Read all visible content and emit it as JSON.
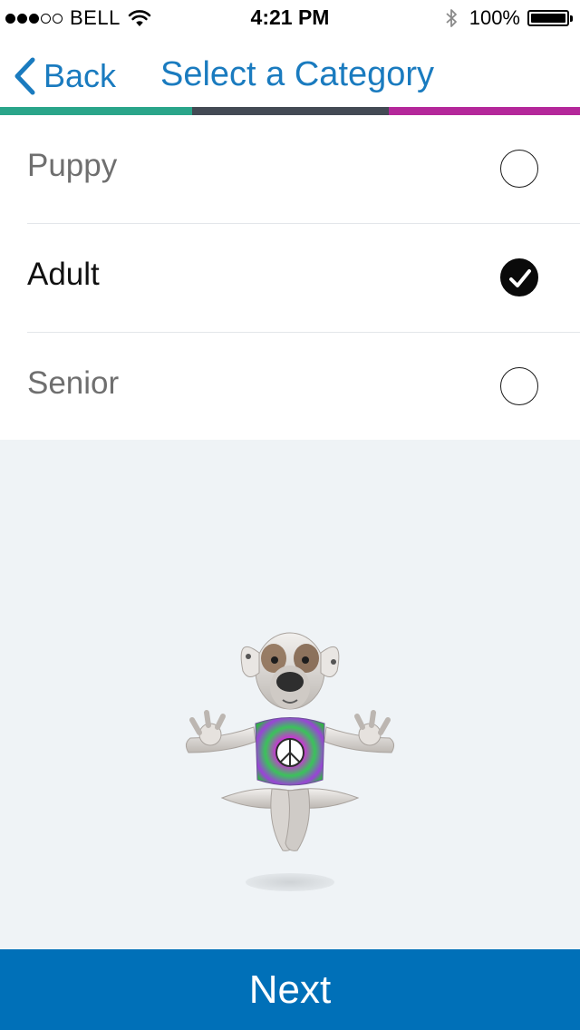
{
  "status_bar": {
    "signal_filled": 3,
    "signal_total": 5,
    "carrier": "BELL",
    "time": "4:21 PM",
    "battery_percent": "100%",
    "battery_level": 1.0,
    "icons": [
      "wifi-icon",
      "bluetooth-icon",
      "battery-icon"
    ]
  },
  "nav": {
    "back_label": "Back",
    "title": "Select a Category",
    "back_icon": "chevron-left-icon"
  },
  "stripe_colors": [
    "#2aa58a",
    "#434a54",
    "#b4279a"
  ],
  "options": [
    {
      "label": "Puppy",
      "selected": false
    },
    {
      "label": "Adult",
      "selected": true
    },
    {
      "label": "Senior",
      "selected": false
    }
  ],
  "illustration": {
    "icon": "meditating-dog-illustration"
  },
  "next_button": {
    "label": "Next"
  },
  "colors": {
    "accent": "#1a7bbf",
    "next_button": "#0070b8",
    "illustration_bg": "#eff3f6"
  }
}
